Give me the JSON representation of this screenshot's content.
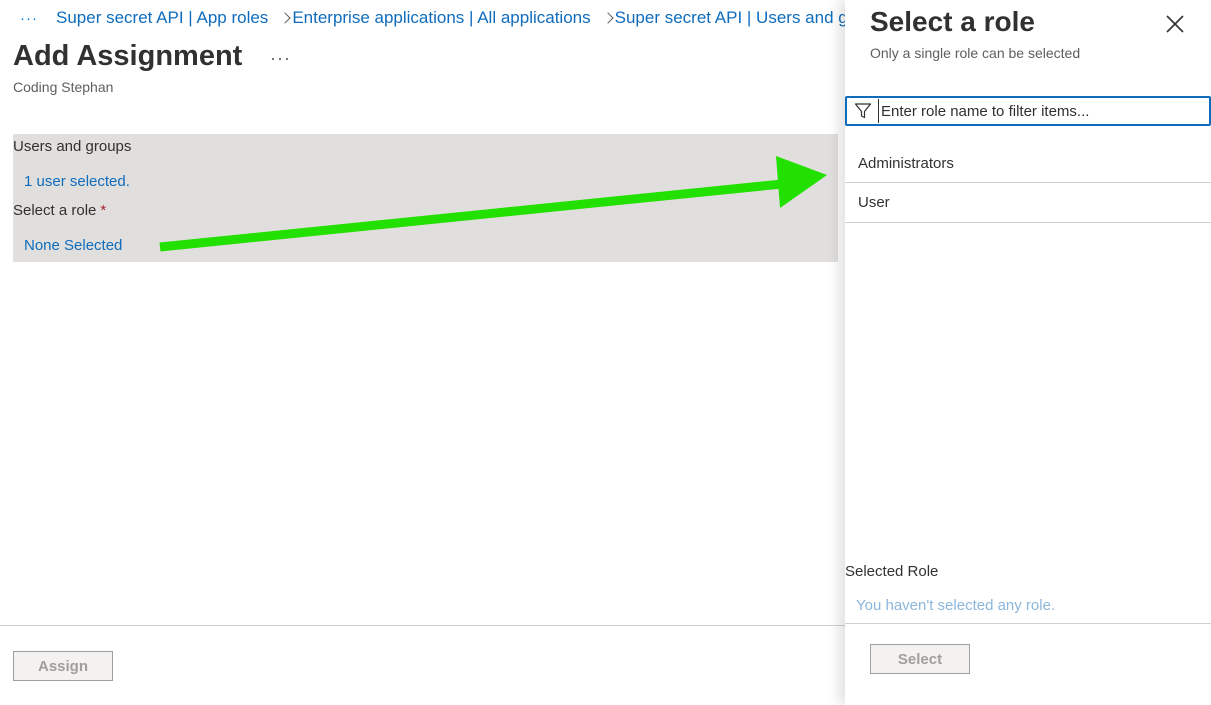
{
  "breadcrumb": {
    "more": "···",
    "items": [
      "Super secret API | App roles",
      "Enterprise applications | All applications",
      "Super secret API | Users and groups"
    ]
  },
  "page": {
    "title": "Add Assignment",
    "more": "···",
    "subtitle": "Coding Stephan"
  },
  "form": {
    "users_label": "Users and groups",
    "users_value": "1 user selected.",
    "role_label": "Select a role",
    "role_required": "*",
    "role_value": "None Selected"
  },
  "footer": {
    "assign_label": "Assign"
  },
  "panel": {
    "title": "Select a role",
    "subtitle": "Only a single role can be selected",
    "filter_placeholder": "Enter role name to filter items...",
    "roles": [
      "Administrators",
      "User"
    ],
    "selected_label": "Selected Role",
    "selected_empty": "You haven't selected any role.",
    "select_label": "Select"
  },
  "colors": {
    "link": "#0f6cbd",
    "arrow": "#22e000",
    "section_bg": "#e1dfdd",
    "required": "#a4262c"
  },
  "icons": {
    "close": "close-icon",
    "filter": "filter-icon",
    "chevron": "chevron-right-icon"
  }
}
